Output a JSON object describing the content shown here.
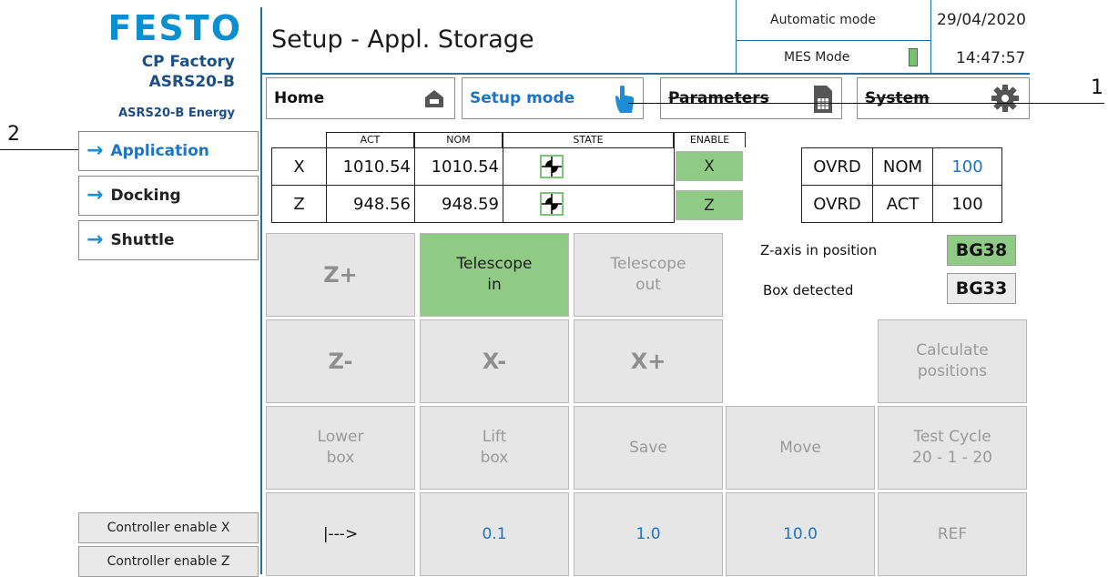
{
  "brand": {
    "logo": "FESTO",
    "line1": "CP Factory",
    "line2": "ASRS20-B",
    "line3": "ASRS20-B Energy"
  },
  "header": {
    "title": "Setup - Appl. Storage",
    "mode1": "Automatic mode",
    "mode2": "MES Mode",
    "date": "29/04/2020",
    "time": "14:47:57"
  },
  "tabs": [
    {
      "label": "Home",
      "icon": "house-icon"
    },
    {
      "label": "Setup mode",
      "icon": "hand-pointer-icon"
    },
    {
      "label": "Parameters",
      "icon": "document-table-icon"
    },
    {
      "label": "System",
      "icon": "gear-icon"
    }
  ],
  "nav": [
    {
      "label": "Application",
      "active": true
    },
    {
      "label": "Docking"
    },
    {
      "label": "Shuttle"
    }
  ],
  "controller": [
    "Controller enable X",
    "Controller enable Z"
  ],
  "positions": {
    "headers": [
      "ACT",
      "NOM",
      "STATE",
      "ENABLE"
    ],
    "rows": [
      {
        "axis": "X",
        "act": "1010.54",
        "nom": "1010.54",
        "enable": "X"
      },
      {
        "axis": "Z",
        "act": "948.56",
        "nom": "948.59",
        "enable": "Z"
      }
    ]
  },
  "override": [
    [
      "OVRD",
      "NOM",
      "100"
    ],
    [
      "OVRD",
      "ACT",
      "100"
    ]
  ],
  "status": [
    {
      "label": "Z-axis in position",
      "code": "BG38"
    },
    {
      "label": "Box detected",
      "code": "BG33"
    }
  ],
  "buttons": {
    "zplus": "Z+",
    "tele_in_1": "Telescope",
    "tele_in_2": "in",
    "tele_out_1": "Telescope",
    "tele_out_2": "out",
    "zminus": "Z-",
    "xminus": "X-",
    "xplus": "X+",
    "calc_1": "Calculate",
    "calc_2": "positions",
    "lower_1": "Lower",
    "lower_2": "box",
    "lift_1": "Lift",
    "lift_2": "box",
    "save": "Save",
    "move": "Move",
    "test_1": "Test Cycle",
    "test_2": "20 - 1 - 20",
    "arrow": "|--->",
    "step1": "0.1",
    "step2": "1.0",
    "step3": "10.0",
    "ref": "REF"
  },
  "callouts": [
    "1",
    "2"
  ],
  "colors": {
    "accent": "#1b8ed6",
    "green": "#8fcb84",
    "line": "#1e6fa7"
  }
}
